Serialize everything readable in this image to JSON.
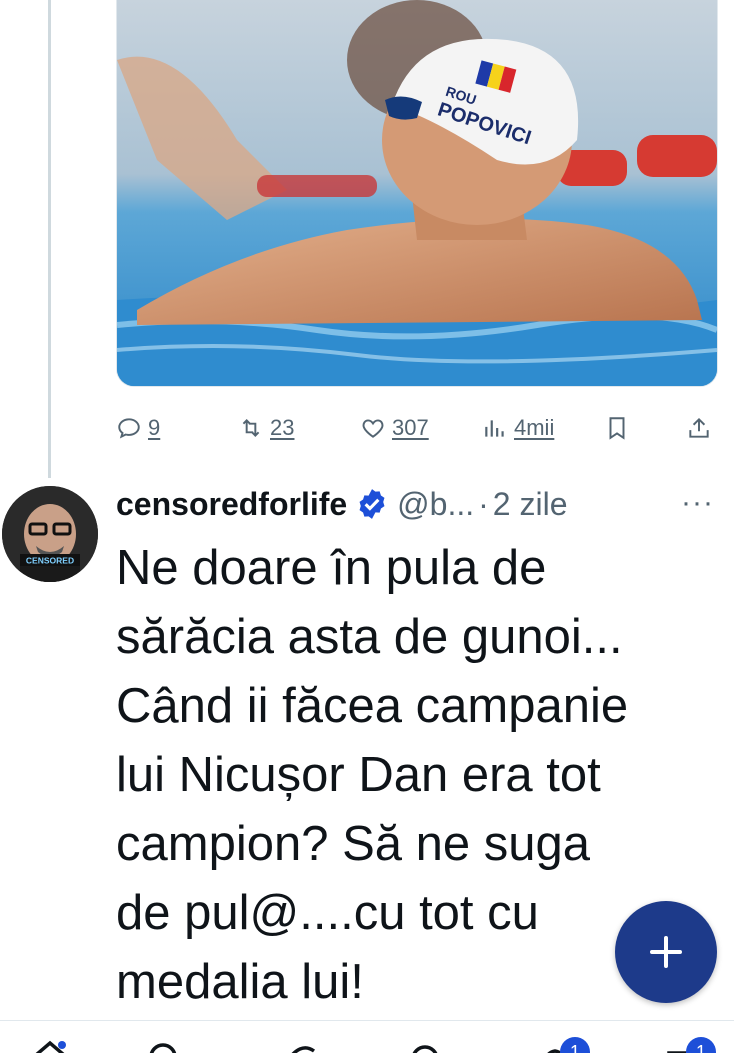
{
  "media": {
    "cap_text": "POPOVICI",
    "cap_country": "ROU"
  },
  "actions": {
    "replies": "9",
    "reposts": "23",
    "likes": "307",
    "views": "4mii"
  },
  "post": {
    "author": "censoredforlife",
    "handle": "@b...",
    "separator": "·",
    "time": "2 zile",
    "more": "···",
    "avatar_label": "CENSORED",
    "text": "Ne doare în pula de\nsărăcia asta de gunoi...\nCând ii făcea campanie\nlui Nicușor Dan era tot\ncampion? Să ne suga\nde pul@....cu tot cu\nmedalia lui!"
  },
  "nav": {
    "badges": [
      "1",
      "1"
    ]
  },
  "colors": {
    "accent": "#1d3a8a",
    "verified": "#1d4fd8",
    "muted": "#536471"
  }
}
